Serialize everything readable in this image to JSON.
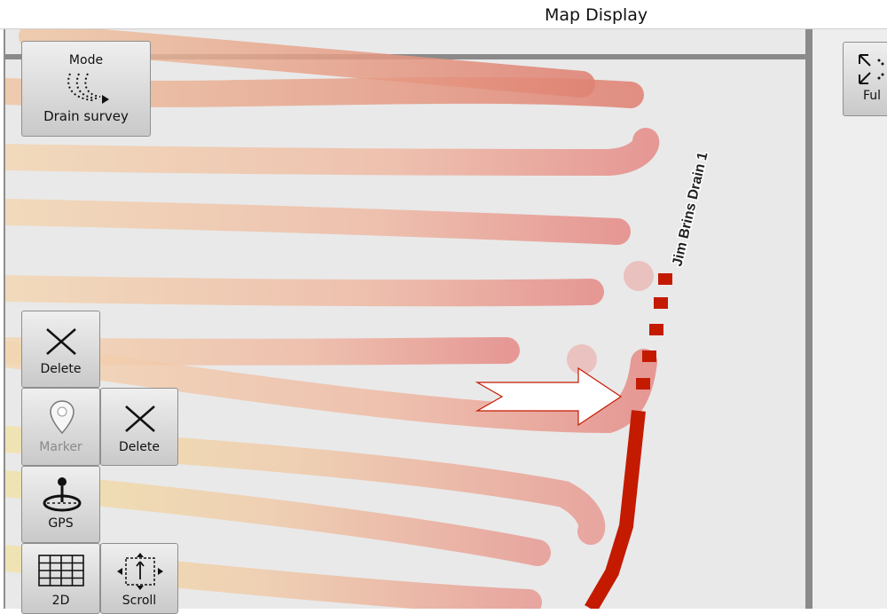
{
  "window": {
    "title": "Map Display"
  },
  "mode_button": {
    "top_label": "Mode",
    "bottom_label": "Drain survey"
  },
  "toolbar": {
    "delete_label": "Delete",
    "marker_label": "Marker",
    "delete2_label": "Delete",
    "gps_label": "GPS",
    "view2d_label": "2D",
    "scroll_label": "Scroll"
  },
  "right_panel": {
    "fullscreen_label": "Ful"
  },
  "map": {
    "drain_label": "Jim Brins Drain 1",
    "drain_color": "#c41a00",
    "trail_color_start": "#f1cfa8",
    "trail_color_end": "#e7898a",
    "marker_arrow_icon": "arrow-right-outline"
  }
}
